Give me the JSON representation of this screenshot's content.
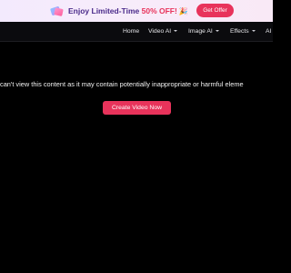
{
  "promo": {
    "text_prefix": "Enjoy Limited-Time ",
    "text_highlight": "50% OFF!",
    "party_glyph": "🎉",
    "button_label": "Get Offer",
    "accent_color": "#e8335b",
    "text_color": "#4a2a8a"
  },
  "nav": {
    "items": [
      {
        "label": "Home",
        "has_dropdown": false
      },
      {
        "label": "Video AI",
        "has_dropdown": true
      },
      {
        "label": "Image AI",
        "has_dropdown": true
      },
      {
        "label": "Effects",
        "has_dropdown": true
      },
      {
        "label": "AI",
        "has_dropdown": false
      }
    ]
  },
  "main": {
    "message": "can't view this content as it may contain potentially inappropriate or harmful eleme",
    "cta_label": "Create Video Now"
  }
}
